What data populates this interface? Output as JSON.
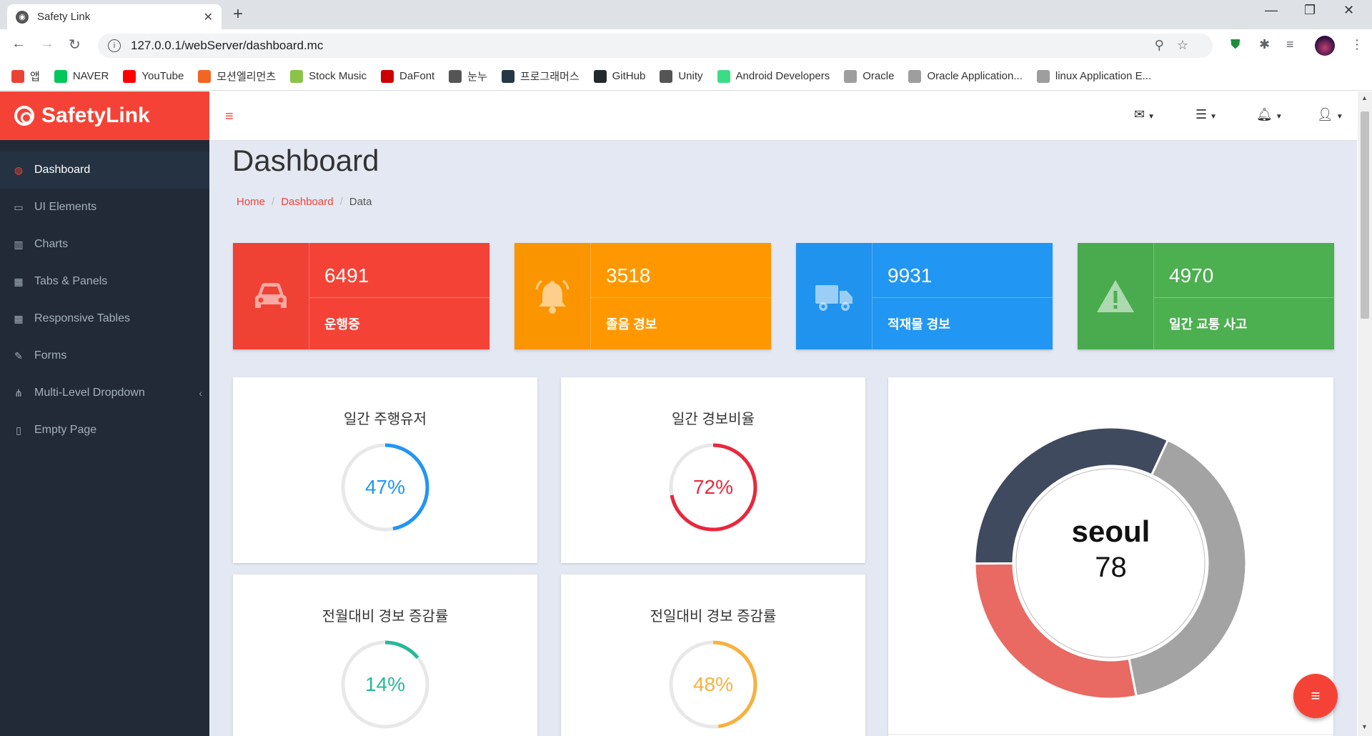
{
  "browser": {
    "tab_title": "Safety Link",
    "tab_close": "✕",
    "new_tab": "+",
    "url": "127.0.0.1/webServer/dashboard.mc",
    "bookmarks": [
      {
        "label": "앱",
        "color": "#ea4335"
      },
      {
        "label": "NAVER",
        "color": "#03c75a"
      },
      {
        "label": "YouTube",
        "color": "#ff0000"
      },
      {
        "label": "모션엘리먼츠",
        "color": "#f26522"
      },
      {
        "label": "Stock Music",
        "color": "#8bc34a"
      },
      {
        "label": "DaFont",
        "color": "#cc0000"
      },
      {
        "label": "눈누",
        "color": "#555555"
      },
      {
        "label": "프로그래머스",
        "color": "#263747"
      },
      {
        "label": "GitHub",
        "color": "#24292e"
      },
      {
        "label": "Unity",
        "color": "#555555"
      },
      {
        "label": "Android Developers",
        "color": "#3ddc84"
      },
      {
        "label": "Oracle",
        "color": "#9e9e9e"
      },
      {
        "label": "Oracle Application...",
        "color": "#9e9e9e"
      },
      {
        "label": "linux Application E...",
        "color": "#9e9e9e"
      }
    ]
  },
  "sidebar": {
    "brand": "SafetyLink",
    "items": [
      {
        "label": "Dashboard",
        "icon": "dashboard-icon",
        "glyph": "◍"
      },
      {
        "label": "UI Elements",
        "icon": "desktop-icon",
        "glyph": "▭"
      },
      {
        "label": "Charts",
        "icon": "bar-chart-icon",
        "glyph": "▥"
      },
      {
        "label": "Tabs & Panels",
        "icon": "tabs-icon",
        "glyph": "▦"
      },
      {
        "label": "Responsive Tables",
        "icon": "table-icon",
        "glyph": "▦"
      },
      {
        "label": "Forms",
        "icon": "edit-icon",
        "glyph": "✎"
      },
      {
        "label": "Multi-Level Dropdown",
        "icon": "sitemap-icon",
        "glyph": "⋔"
      },
      {
        "label": "Empty Page",
        "icon": "file-icon",
        "glyph": "▯"
      }
    ]
  },
  "page": {
    "title": "Dashboard",
    "breadcrumb": [
      "Home",
      "Dashboard",
      "Data"
    ]
  },
  "stats": [
    {
      "value": "6491",
      "label": "운행중",
      "color": "#f44336",
      "icon": "car-icon"
    },
    {
      "value": "3518",
      "label": "졸음 경보",
      "color": "#ff9800",
      "icon": "bell-icon"
    },
    {
      "value": "9931",
      "label": "적재물 경보",
      "color": "#2196f3",
      "icon": "truck-icon"
    },
    {
      "value": "4970",
      "label": "일간 교통 사고",
      "color": "#4caf50",
      "icon": "warning-icon"
    }
  ],
  "gauges": [
    {
      "title": "일간 주행유저",
      "percent": 47,
      "label": "47%",
      "color": "#2196f3"
    },
    {
      "title": "일간 경보비율",
      "percent": 72,
      "label": "72%",
      "color": "#e8283d"
    },
    {
      "title": "전월대비 경보 증감률",
      "percent": 14,
      "label": "14%",
      "color": "#26b99a"
    },
    {
      "title": "전일대비 경보 증감률",
      "percent": 48,
      "label": "48%",
      "color": "#f7b13e"
    }
  ],
  "chart_data": {
    "type": "pie",
    "center_label": "seoul",
    "center_value": "78",
    "series": [
      {
        "value": 40,
        "color": "#a3a3a3"
      },
      {
        "value": 28,
        "color": "#e86a63"
      },
      {
        "value": 32,
        "color": "#3f4a5e"
      }
    ]
  }
}
